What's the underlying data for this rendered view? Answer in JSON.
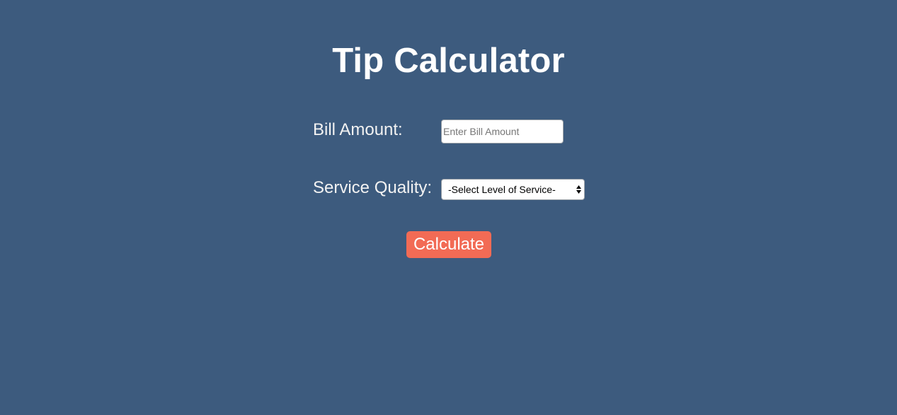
{
  "page": {
    "title": "Tip Calculator",
    "background_color": "#3d5b7e"
  },
  "form": {
    "bill_label": "Bill Amount:",
    "bill_value": "",
    "bill_placeholder": "Enter Bill Amount",
    "service_label": "Service Quality:",
    "service_selected": "-Select Level of Service-",
    "service_icon": "up-down-arrows-icon",
    "calculate_label": "Calculate",
    "calculate_color": "#f26b55"
  }
}
